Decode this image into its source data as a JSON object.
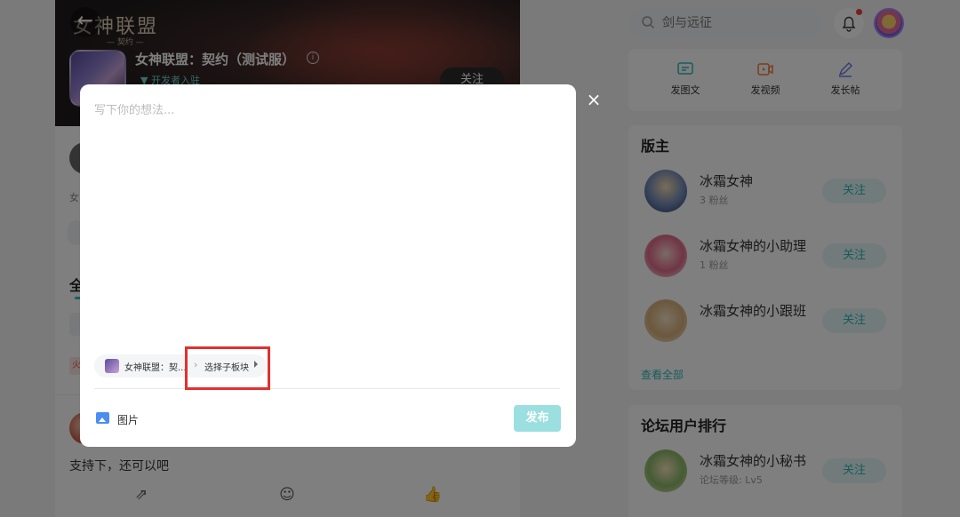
{
  "header": {
    "game_title": "女神联盟：契约（测试服）",
    "logo_text": "女神联盟",
    "logo_sub": "— 契约 —",
    "developer_badge": "开发者入驻",
    "follow_label": "关注"
  },
  "search": {
    "placeholder": "剑与远征"
  },
  "post_actions": [
    {
      "label": "发图文",
      "icon": "image-text-icon"
    },
    {
      "label": "发视频",
      "icon": "video-icon"
    },
    {
      "label": "发长帖",
      "icon": "pen-icon"
    }
  ],
  "moderators": {
    "title": "版主",
    "items": [
      {
        "name": "冰霜女神",
        "fans": "3 粉丝",
        "follow": "关注"
      },
      {
        "name": "冰霜女神的小助理",
        "fans": "1 粉丝",
        "follow": "关注"
      },
      {
        "name": "冰霜女神的小跟班",
        "fans": "",
        "follow": "关注"
      }
    ],
    "view_all": "查看全部"
  },
  "ranking": {
    "title": "论坛用户排行",
    "items": [
      {
        "name": "冰霜女神的小秘书",
        "level": "论坛等级: Lv5",
        "follow": "关注"
      }
    ]
  },
  "feed": {
    "post_text": "支持下，还可以吧",
    "tab_label": "全",
    "partial_text": "女",
    "hot_tag": "火"
  },
  "modal": {
    "placeholder": "写下你的想法...",
    "board_name": "女神联盟：契...",
    "sub_board": "选择子板块",
    "image_label": "图片",
    "publish_label": "发布",
    "close_symbol": "×"
  },
  "colors": {
    "accent": "#2eb8bb",
    "publish_disabled": "#9bdfe0",
    "highlight": "#e23030",
    "notification_dot": "#f03c3c"
  }
}
